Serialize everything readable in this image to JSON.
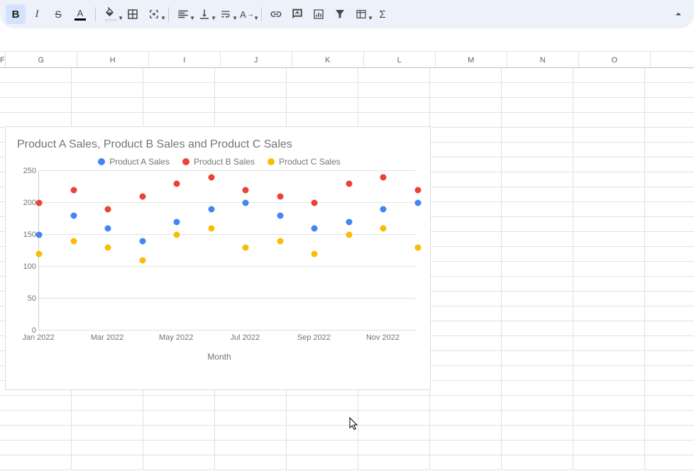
{
  "toolbar": {
    "bold": "B",
    "italic": "I",
    "strike": "S"
  },
  "columns": [
    "F",
    "G",
    "H",
    "I",
    "J",
    "K",
    "L",
    "M",
    "N",
    "O"
  ],
  "chart_data": {
    "type": "scatter",
    "title": "Product A Sales, Product B Sales and Product C Sales",
    "xlabel": "Month",
    "ylabel": "",
    "ylim": [
      0,
      250
    ],
    "yticks": [
      0,
      50,
      100,
      150,
      200,
      250
    ],
    "categories": [
      "Jan 2022",
      "Feb 2022",
      "Mar 2022",
      "Apr 2022",
      "May 2022",
      "Jun 2022",
      "Jul 2022",
      "Aug 2022",
      "Sep 2022",
      "Oct 2022",
      "Nov 2022",
      "Dec 2022"
    ],
    "xticks_shown": [
      "Jan 2022",
      "Mar 2022",
      "May 2022",
      "Jul 2022",
      "Sep 2022",
      "Nov 2022"
    ],
    "series": [
      {
        "name": "Product A Sales",
        "color": "#4285f4",
        "values": [
          150,
          180,
          160,
          140,
          170,
          190,
          200,
          180,
          160,
          170,
          190,
          200
        ]
      },
      {
        "name": "Product B Sales",
        "color": "#ea4335",
        "values": [
          200,
          220,
          190,
          210,
          230,
          240,
          220,
          210,
          200,
          230,
          240,
          220
        ]
      },
      {
        "name": "Product C Sales",
        "color": "#fbbc04",
        "values": [
          120,
          140,
          130,
          110,
          150,
          160,
          130,
          140,
          120,
          150,
          160,
          130
        ]
      }
    ]
  }
}
